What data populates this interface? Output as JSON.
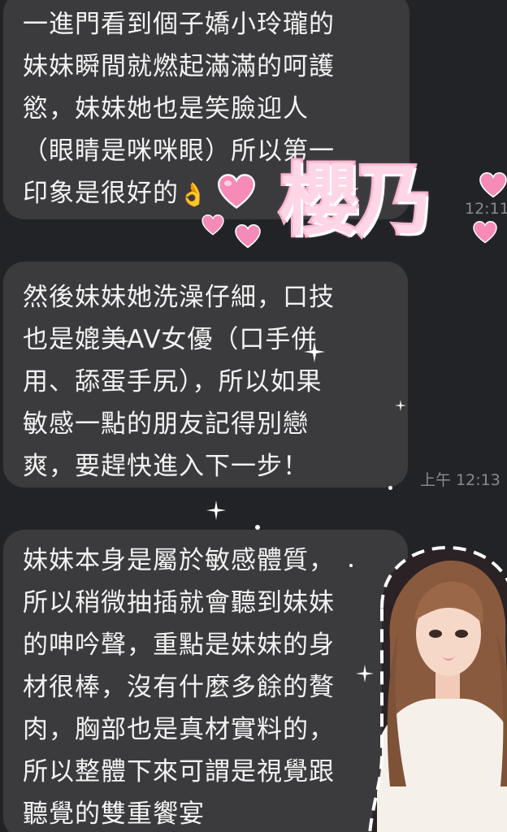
{
  "messages": [
    {
      "lines": [
        "一進門看到個子嬌小玲瓏的",
        "妹妹瞬間就燃起滿滿的呵護",
        "慾，妹妹她也是笑臉迎人",
        "（眼睛是咪咪眼）所以第一",
        "印象是很好的"
      ],
      "emoji": "👌",
      "time": "12:11"
    },
    {
      "lines": [
        "然後妹妹她洗澡仔細，口技",
        "也是媲美AV女優（口手併",
        "用、舔蛋手尻），所以如果",
        "敏感一點的朋友記得別戀",
        "爽，要趕快進入下一步！"
      ],
      "time": "上午 12:13"
    },
    {
      "lines": [
        "妹妹本身是屬於敏感體質，",
        "所以稍微抽插就會聽到妹妹",
        "的呻吟聲，重點是妹妹的身",
        "材很棒，沒有什麼多餘的贅",
        "肉，胸部也是真材實料的，",
        "所以整體下來可謂是視覺跟",
        "聽覺的雙重饗宴"
      ]
    }
  ],
  "sticker": {
    "title": "櫻乃",
    "heart_icon": "heart-icon",
    "sparkle_icon": "sparkle-icon",
    "avatar_icon": "avatar-portrait-icon"
  },
  "colors": {
    "background": "#222326",
    "bubble": "#3b3b3e",
    "text": "#f3f3f3",
    "timestamp": "#8a8a8d",
    "heart_pink": "#f58bb6",
    "title_fill": "#ffd6e6",
    "title_stroke": "#f7a9c9"
  }
}
